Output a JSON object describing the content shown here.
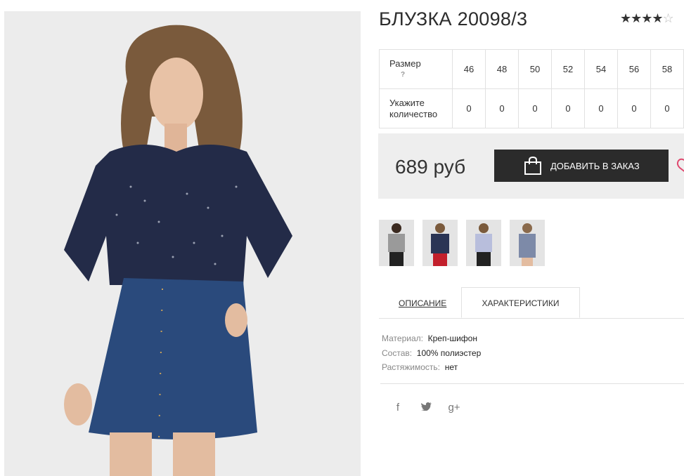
{
  "product": {
    "title": "БЛУЗКА 20098/3",
    "rating": 4,
    "rating_max": 5,
    "stars_on": "★★★★",
    "stars_off": "☆"
  },
  "size_table": {
    "size_label": "Размер",
    "help": "?",
    "qty_label": "Укажите количество",
    "sizes": [
      "46",
      "48",
      "50",
      "52",
      "54",
      "56",
      "58"
    ],
    "quantities": [
      "0",
      "0",
      "0",
      "0",
      "0",
      "0",
      "0"
    ]
  },
  "purchase": {
    "price": "689 руб",
    "add_label": "ДОБАВИТЬ В ЗАКАЗ",
    "add_icon": "shopping-bag-icon",
    "wishlist_icon": "heart-icon"
  },
  "tabs": {
    "description": "ОПИСАНИЕ",
    "characteristics": "ХАРАКТЕРИСТИКИ"
  },
  "specs": [
    {
      "key": "Материал:",
      "value": "Креп-шифон"
    },
    {
      "key": "Состав:",
      "value": "100% полиэстер"
    },
    {
      "key": "Растяжимость:",
      "value": "нет"
    }
  ],
  "social": {
    "facebook": "f",
    "twitter": "t",
    "googleplus": "g+"
  },
  "colors": {
    "button_bg": "#2b2b2b",
    "price_box_bg": "#eeeeee",
    "heart": "#e0496f",
    "blouse": "#232b48",
    "denim": "#2a4a7c"
  }
}
